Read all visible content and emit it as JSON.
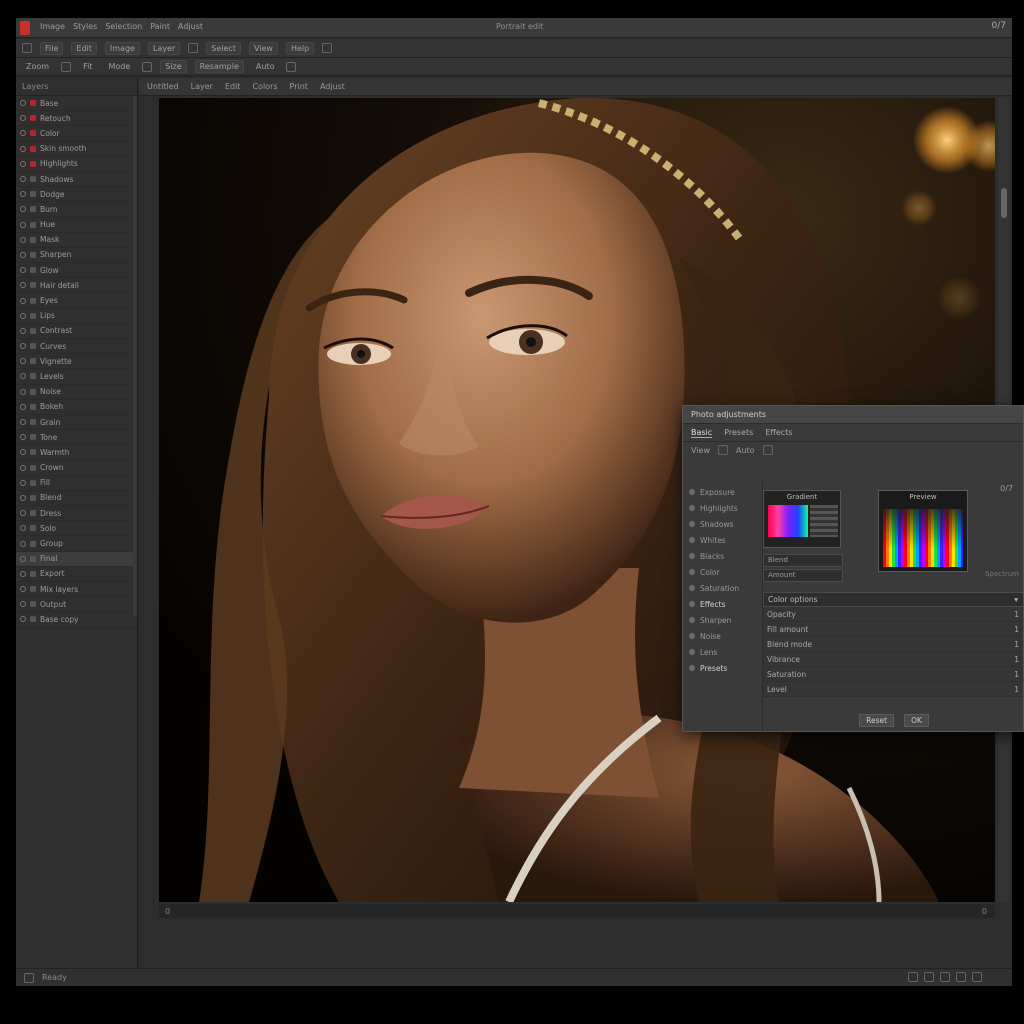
{
  "titlebar": {
    "menu": [
      "Image",
      "Styles",
      "Selection",
      "Paint",
      "Adjust"
    ],
    "center_title": "Portrait edit",
    "right_label": "0/7"
  },
  "toolbar1": {
    "items": [
      "File",
      "Edit",
      "Image",
      "Layer",
      "Select",
      "View",
      "Help"
    ]
  },
  "toolbar2": {
    "items": [
      "Zoom",
      "Fit",
      "Mode",
      "Size",
      "Resample",
      "Auto"
    ]
  },
  "left_panel": {
    "header": "Layers",
    "layers": [
      {
        "label": "Base",
        "swatch": "#b3262a"
      },
      {
        "label": "Retouch",
        "swatch": "#b3262a"
      },
      {
        "label": "Color",
        "swatch": "#b3262a"
      },
      {
        "label": "Skin smooth",
        "swatch": "#b3262a"
      },
      {
        "label": "Highlights",
        "swatch": "#b3262a"
      },
      {
        "label": "Shadows",
        "swatch": "#555555"
      },
      {
        "label": "Dodge",
        "swatch": "#555555"
      },
      {
        "label": "Burn",
        "swatch": "#555555"
      },
      {
        "label": "Hue",
        "swatch": "#555555"
      },
      {
        "label": "Mask",
        "swatch": "#555555"
      },
      {
        "label": "Sharpen",
        "swatch": "#555555"
      },
      {
        "label": "Glow",
        "swatch": "#555555"
      },
      {
        "label": "Hair detail",
        "swatch": "#555555"
      },
      {
        "label": "Eyes",
        "swatch": "#555555"
      },
      {
        "label": "Lips",
        "swatch": "#555555"
      },
      {
        "label": "Contrast",
        "swatch": "#555555"
      },
      {
        "label": "Curves",
        "swatch": "#555555"
      },
      {
        "label": "Vignette",
        "swatch": "#555555"
      },
      {
        "label": "Levels",
        "swatch": "#555555"
      },
      {
        "label": "Noise",
        "swatch": "#555555"
      },
      {
        "label": "Bokeh",
        "swatch": "#555555"
      },
      {
        "label": "Grain",
        "swatch": "#555555"
      },
      {
        "label": "Tone",
        "swatch": "#555555"
      },
      {
        "label": "Warmth",
        "swatch": "#555555"
      },
      {
        "label": "Crown",
        "swatch": "#555555"
      },
      {
        "label": "Fill",
        "swatch": "#555555"
      },
      {
        "label": "Blend",
        "swatch": "#555555"
      },
      {
        "label": "Dress",
        "swatch": "#555555"
      },
      {
        "label": "Solo",
        "swatch": "#555555"
      },
      {
        "label": "Group",
        "swatch": "#555555"
      },
      {
        "label": "Final",
        "swatch": "#555555"
      },
      {
        "label": "Export",
        "swatch": "#555555"
      },
      {
        "label": "Mix layers",
        "swatch": "#555555"
      },
      {
        "label": "Output",
        "swatch": "#555555"
      },
      {
        "label": "Base copy",
        "swatch": "#555555"
      }
    ]
  },
  "canvas": {
    "tabs": [
      "Untitled",
      "Layer",
      "Edit",
      "Colors",
      "Print",
      "Adjust"
    ],
    "status_left": "0",
    "status_right": "0"
  },
  "bottom_bar": {
    "left": "Ready",
    "icons": [
      "zoom-in",
      "zoom-out",
      "grid",
      "rulers",
      "fit"
    ]
  },
  "float_panel": {
    "title": "Photo adjustments",
    "tabs": [
      "Basic",
      "Presets",
      "Effects"
    ],
    "row1": [
      "View",
      "Auto"
    ],
    "side_items": [
      "Exposure",
      "Highlights",
      "Shadows",
      "Whites",
      "Blacks",
      "Color",
      "Saturation",
      "Effects",
      "Sharpen",
      "Noise",
      "Lens",
      "Presets"
    ],
    "swatch_label": "Gradient",
    "preview_label": "Preview",
    "corner": "0/7",
    "corner2": "Spectrum",
    "mini_fields": [
      "Blend",
      "Amount"
    ],
    "props_head": "Color options",
    "props": [
      {
        "label": "Opacity",
        "value": "1"
      },
      {
        "label": "Fill amount",
        "value": "1"
      },
      {
        "label": "Blend mode",
        "value": "1"
      },
      {
        "label": "Vibrance",
        "value": "1"
      },
      {
        "label": "Saturation",
        "value": "1"
      },
      {
        "label": "Level",
        "value": "1"
      }
    ],
    "buttons": [
      "Reset",
      "OK"
    ]
  }
}
